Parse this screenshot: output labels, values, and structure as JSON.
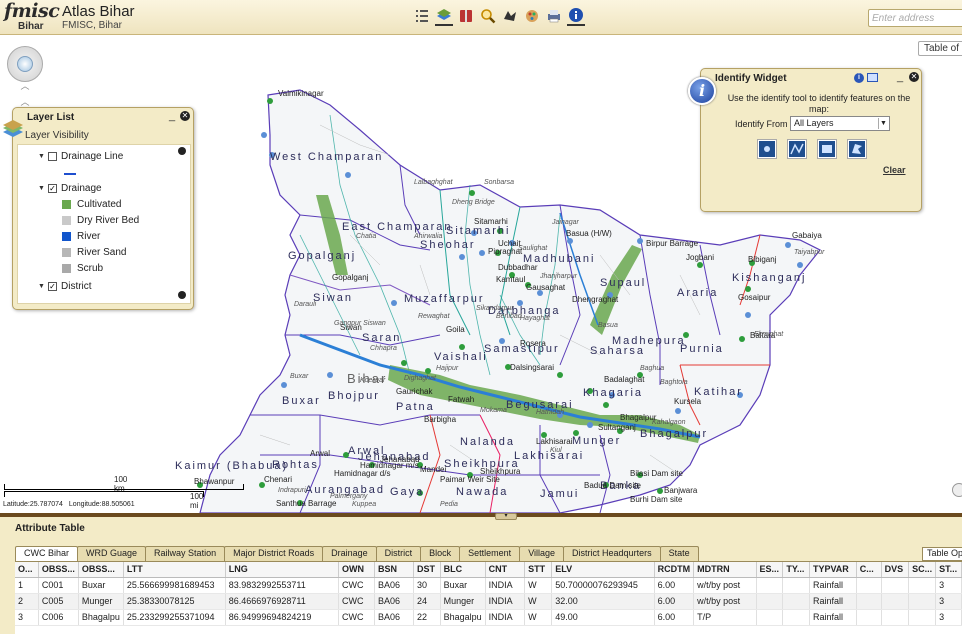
{
  "header": {
    "logo_main": "fmisc",
    "logo_sub": "Bihar",
    "title": "Atlas Bihar",
    "subtitle": "FMISC, Bihar",
    "address_placeholder": "Enter address",
    "toolbar": [
      "list-icon",
      "basemap-icon",
      "bookmark-icon",
      "search-icon",
      "measure-icon",
      "print-icon",
      "draw-icon",
      "info-icon"
    ]
  },
  "map": {
    "table_of_contents_label": "Table of C",
    "scale": {
      "label_top": "100 km",
      "label_bottom": "100 mi"
    },
    "coords": {
      "latitude": "Latitude:25.787074",
      "longitude": "Longitude:88.505061"
    },
    "district_labels": [
      "West Champaran",
      "East Champaran",
      "Sitamarhi",
      "Sheohar",
      "Gopalganj",
      "Siwan",
      "Muzaffarpur",
      "Madhubani",
      "Darbhanga",
      "Supaul",
      "Araria",
      "Kishanganj",
      "Saran",
      "Vaishali",
      "Samastipur",
      "Saharsa",
      "Madhepura",
      "Purnia",
      "Bihar",
      "Buxar",
      "Bhojpur",
      "Patna",
      "Begusarai",
      "Khagaria",
      "Katihar",
      "Munger",
      "Bhagalpur",
      "Nalanda",
      "Lakhisarai",
      "Sheikhpura",
      "Arwal",
      "Jehanabad",
      "Rohtas",
      "Kaimur (Bhabua)",
      "Gaya",
      "Nawada",
      "Jamui",
      "Banka",
      "Aurangabad"
    ],
    "place_labels": [
      "Valmikinagar",
      "Sonbarsa",
      "Lalbaghghat",
      "Dheng Bridge",
      "Sitamarhi",
      "Jainagar",
      "Basua (H/W)",
      "Birpur Barrage",
      "Gabaiya",
      "Taiyabpur",
      "Jogbani",
      "Bibiganj",
      "Gosaipur",
      "Chatia",
      "Ahirwalia",
      "Uchait",
      "Pipraghat",
      "Saulighat",
      "Dubbadhar",
      "Kamtaul",
      "Jhanjharpur",
      "Gausaghat",
      "Dhengraghat",
      "Baltara",
      "Ekmighat",
      "Gopalganj",
      "Siwan",
      "Darauli",
      "Gangpur Siswan",
      "Chhapra",
      "Rewaghat",
      "Goila",
      "Benibad",
      "Sikandarpur",
      "Hayaghat",
      "Rosera",
      "Dalsingsarai",
      "Basua",
      "Baghua",
      "Baghtola",
      "Badalaghat",
      "Kursela",
      "Bhagalpur",
      "Hajipur",
      "Hathidah",
      "Gaurichak",
      "Fatwah",
      "Barbigha",
      "Buxar",
      "Koelwar",
      "Dighaghat",
      "Sultanganj",
      "Kahalgaon",
      "Lakhisarai",
      "Kiul",
      "Mokama",
      "Arwal",
      "Jehanabad",
      "Hamidnagar m/s",
      "Hamidnagar d/s",
      "Mandei",
      "Paimar Weir Site",
      "Sheikhpura",
      "Bilasi Dam site",
      "Badua Dam site",
      "Banjwara",
      "Burhi Dam site",
      "Bhawanpur",
      "Chenari",
      "Indrapuri",
      "Santhua Barrage",
      "Palmergany",
      "Kuppea",
      "Pedia"
    ]
  },
  "layer_list": {
    "title": "Layer List",
    "visibility_label": "Layer Visibility",
    "layers": [
      {
        "name": "Drainage Line",
        "checked": false,
        "legend": []
      },
      {
        "name": "Drainage",
        "checked": true,
        "legend": [
          {
            "label": "Cultivated",
            "color": "#6aa84f"
          },
          {
            "label": "Dry River Bed",
            "color": "#c9c9c9"
          },
          {
            "label": "River",
            "color": "#1155cc"
          },
          {
            "label": "River Sand",
            "color": "#b7b7b7"
          },
          {
            "label": "Scrub",
            "color": "#a9a9a9"
          }
        ]
      },
      {
        "name": "District",
        "checked": true,
        "legend": []
      }
    ]
  },
  "identify_widget": {
    "title": "Identify Widget",
    "description": "Use the identify tool to identify features on the map:",
    "identify_from_label": "Identify From",
    "identify_from_value": "All Layers",
    "tools": [
      "point-tool-icon",
      "polyline-tool-icon",
      "rectangle-tool-icon",
      "polygon-tool-icon"
    ],
    "clear_label": "Clear"
  },
  "attribute_table": {
    "title": "Attribute Table",
    "table_options_label": "Table Opt",
    "tabs": [
      "CWC Bihar",
      "WRD Guage",
      "Railway Station",
      "Major District Roads",
      "Drainage",
      "District",
      "Block",
      "Settlement",
      "Village",
      "District Headqurters",
      "State"
    ],
    "active_tab": 0,
    "columns": [
      "O...",
      "OBSS...",
      "OBSS...",
      "LTT",
      "LNG",
      "OWN",
      "BSN",
      "DST",
      "BLC",
      "CNT",
      "STT",
      "ELV",
      "RCDTM",
      "MDTRN",
      "ES...",
      "TY...",
      "TYPVAR",
      "C...",
      "DVS",
      "SC...",
      "ST..."
    ],
    "rows": [
      [
        "1",
        "C001",
        "Buxar",
        "25.566699981689453",
        "83.9832992553711",
        "CWC",
        "BA06",
        "30",
        "Buxar",
        "INDIA",
        "W",
        "50.70000076293945",
        "6.00",
        "w/t/by post",
        "",
        "",
        "Rainfall",
        "",
        "",
        "",
        "3"
      ],
      [
        "2",
        "C005",
        "Munger",
        "25.38330078125",
        "86.4666976928711",
        "CWC",
        "BA06",
        "24",
        "Munger",
        "INDIA",
        "W",
        "32.00",
        "6.00",
        "w/t/by post",
        "",
        "",
        "Rainfall",
        "",
        "",
        "",
        "3"
      ],
      [
        "3",
        "C006",
        "Bhagalpu",
        "25.233299255371094",
        "86.94999694824219",
        "CWC",
        "BA06",
        "22",
        "Bhagalpu",
        "INDIA",
        "W",
        "49.00",
        "6.00",
        "T/P",
        "",
        "",
        "Rainfall",
        "",
        "",
        "",
        "3"
      ]
    ]
  },
  "colors": {
    "panel_bg": "#f3ebc7",
    "district_border": "#5a3db8",
    "river": "#2b7fd6",
    "cultivated": "#6aa84f",
    "drainage_line": "#26a69a"
  }
}
